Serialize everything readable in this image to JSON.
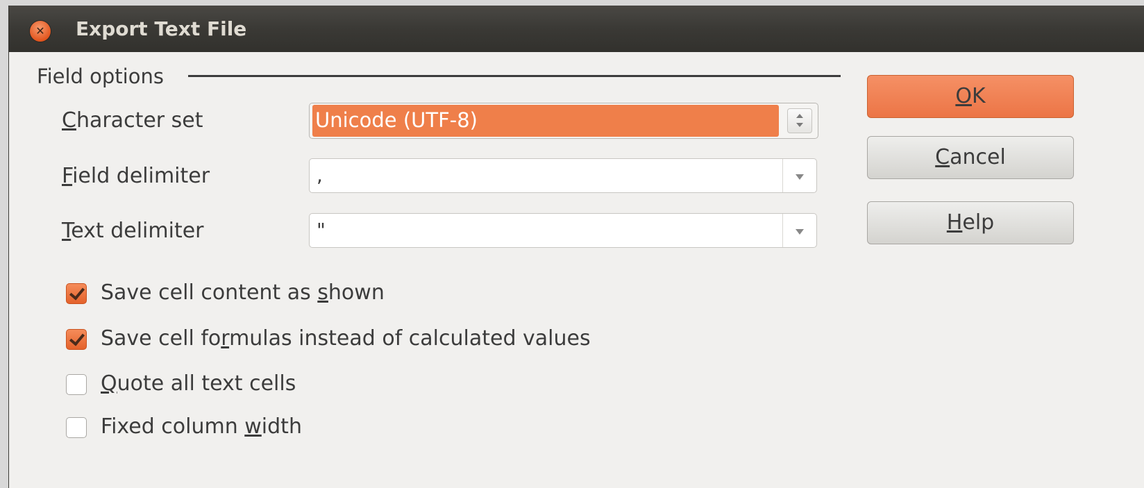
{
  "window": {
    "title": "Export Text File",
    "close_icon": "close-icon"
  },
  "field_options": {
    "section_title": "Field options",
    "character_set": {
      "label_first": "C",
      "label_rest": "haracter set",
      "value": "Unicode (UTF-8)"
    },
    "field_delimiter": {
      "label_first": "F",
      "label_rest": "ield delimiter",
      "value": ","
    },
    "text_delimiter": {
      "label_first": "T",
      "label_rest": "ext delimiter",
      "value": "\""
    }
  },
  "checkboxes": [
    {
      "pre": "Save cell content as ",
      "ul": "s",
      "post": "hown",
      "checked": true
    },
    {
      "pre": "Save cell fo",
      "ul": "r",
      "post": "mulas instead of calculated values",
      "checked": true
    },
    {
      "pre": "",
      "ul": "Q",
      "post": "uote all text cells",
      "checked": false
    },
    {
      "pre": "Fixed column ",
      "ul": "w",
      "post": "idth",
      "checked": false
    }
  ],
  "buttons": {
    "ok": {
      "ul": "O",
      "rest": "K"
    },
    "cancel": {
      "ul": "C",
      "rest": "ancel"
    },
    "help": {
      "ul": "H",
      "rest": "elp"
    }
  },
  "colors": {
    "accent": "#ef7f4a",
    "titlebar": "#3a3935",
    "background": "#f1f0ee"
  }
}
